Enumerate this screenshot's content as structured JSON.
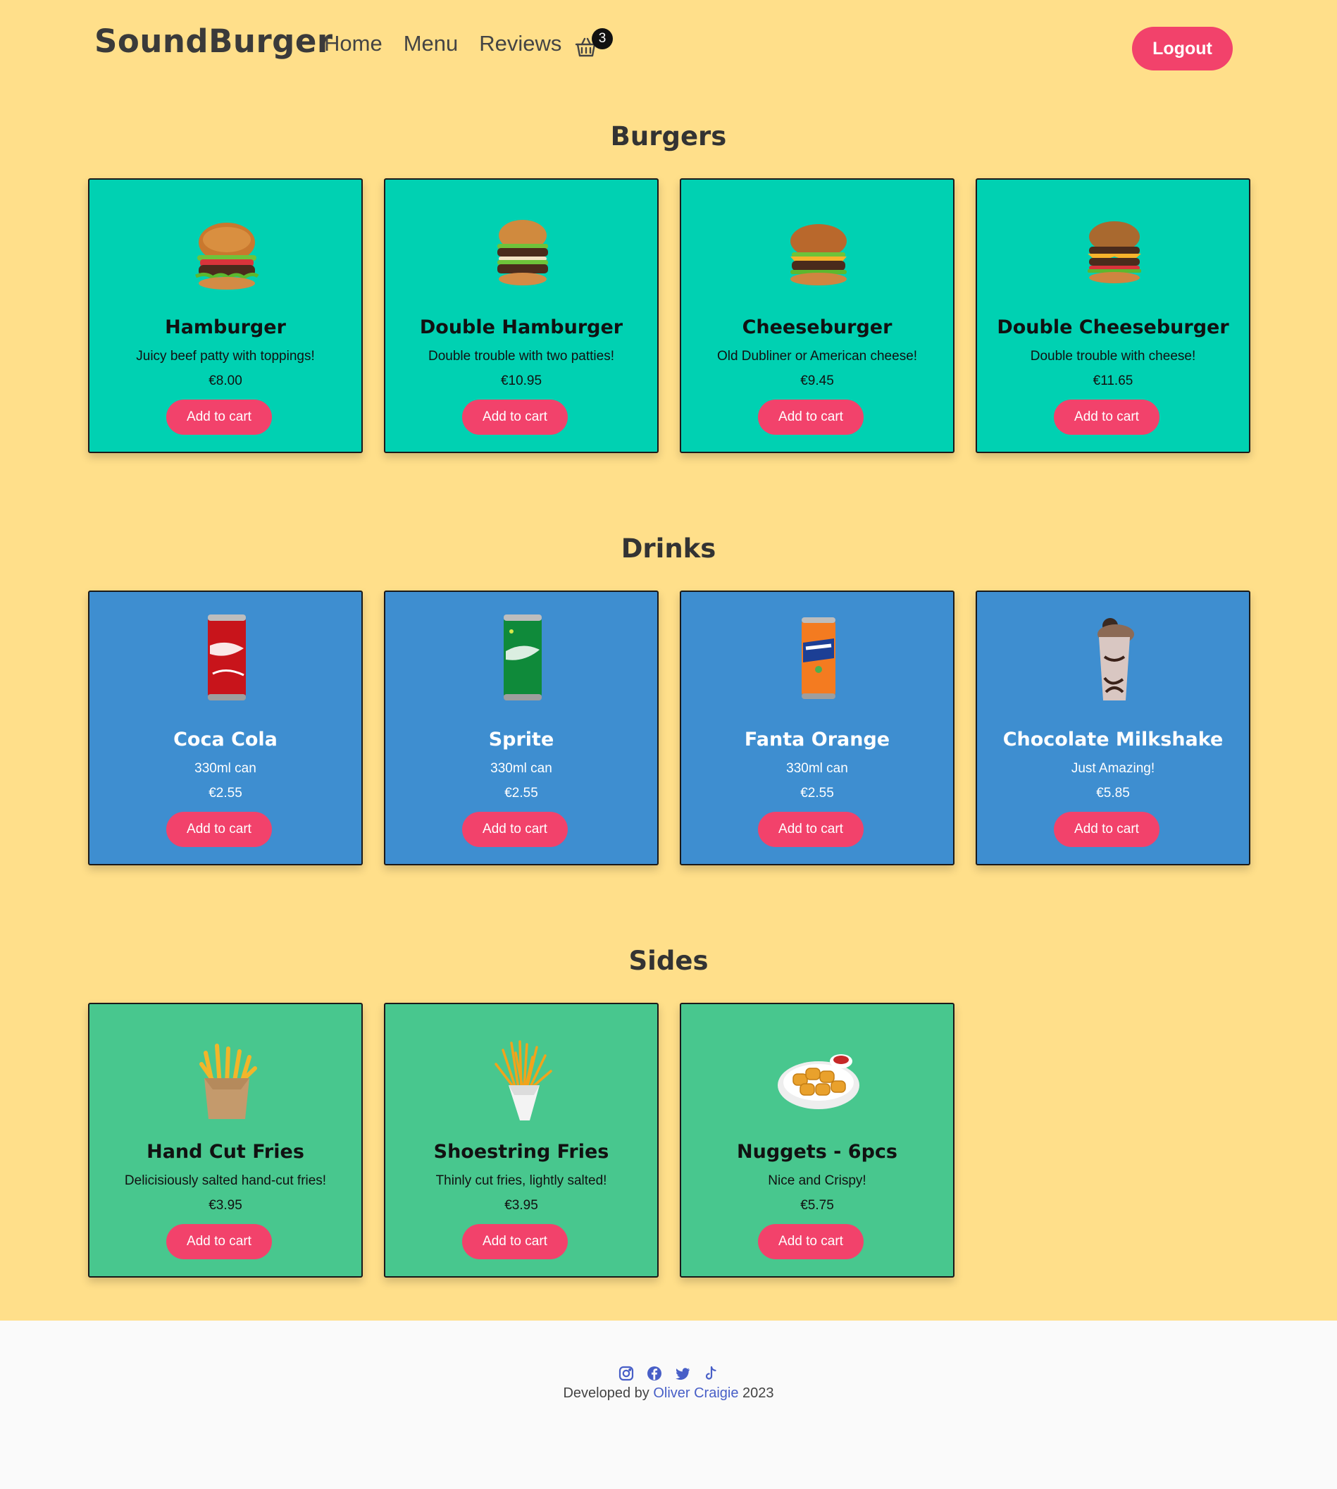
{
  "brand": "SoundBurger",
  "nav": {
    "home": "Home",
    "menu": "Menu",
    "reviews": "Reviews",
    "cart_count": "3",
    "logout": "Logout"
  },
  "sections": {
    "burgers": {
      "title": "Burgers",
      "items": [
        {
          "name": "Hamburger",
          "desc": "Juicy beef patty with toppings!",
          "price": "€8.00",
          "button": "Add to cart"
        },
        {
          "name": "Double Hamburger",
          "desc": "Double trouble with two patties!",
          "price": "€10.95",
          "button": "Add to cart"
        },
        {
          "name": "Cheeseburger",
          "desc": "Old Dubliner or American cheese!",
          "price": "€9.45",
          "button": "Add to cart"
        },
        {
          "name": "Double Cheeseburger",
          "desc": "Double trouble with cheese!",
          "price": "€11.65",
          "button": "Add to cart"
        }
      ]
    },
    "drinks": {
      "title": "Drinks",
      "items": [
        {
          "name": "Coca Cola",
          "desc": "330ml can",
          "price": "€2.55",
          "button": "Add to cart"
        },
        {
          "name": "Sprite",
          "desc": "330ml can",
          "price": "€2.55",
          "button": "Add to cart"
        },
        {
          "name": "Fanta Orange",
          "desc": "330ml can",
          "price": "€2.55",
          "button": "Add to cart"
        },
        {
          "name": "Chocolate Milkshake",
          "desc": "Just Amazing!",
          "price": "€5.85",
          "button": "Add to cart"
        }
      ]
    },
    "sides": {
      "title": "Sides",
      "items": [
        {
          "name": "Hand Cut Fries",
          "desc": "Delicisiously salted hand-cut fries!",
          "price": "€3.95",
          "button": "Add to cart"
        },
        {
          "name": "Shoestring Fries",
          "desc": "Thinly cut fries, lightly salted!",
          "price": "€3.95",
          "button": "Add to cart"
        },
        {
          "name": "Nuggets - 6pcs",
          "desc": "Nice and Crispy!",
          "price": "€5.75",
          "button": "Add to cart"
        }
      ]
    }
  },
  "footer": {
    "icons": [
      "instagram-icon",
      "facebook-icon",
      "twitter-icon",
      "tiktok-icon"
    ],
    "prefix": "Developed by",
    "author": "Oliver Craigie",
    "year": "2023"
  },
  "colors": {
    "background": "#ffdf8a",
    "accent": "#f2426b",
    "burger_card": "#00d1b2",
    "drink_card": "#3e8ed0",
    "side_card": "#48c78e",
    "footer": "#fafafa"
  }
}
